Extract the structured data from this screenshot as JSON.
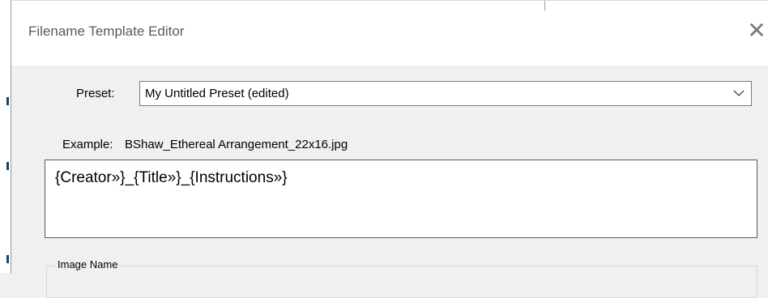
{
  "dialog": {
    "title": "Filename Template Editor",
    "close_icon": "close-icon"
  },
  "preset": {
    "label": "Preset:",
    "value": "My Untitled Preset (edited)",
    "dropdown_icon": "chevron-down-icon"
  },
  "example": {
    "label": "Example:",
    "value": "BShaw_Ethereal Arrangement_22x16.jpg"
  },
  "template": {
    "value": "{Creator»}_{Title»}_{Instructions»}"
  },
  "image_name_group": {
    "label": "Image Name"
  }
}
